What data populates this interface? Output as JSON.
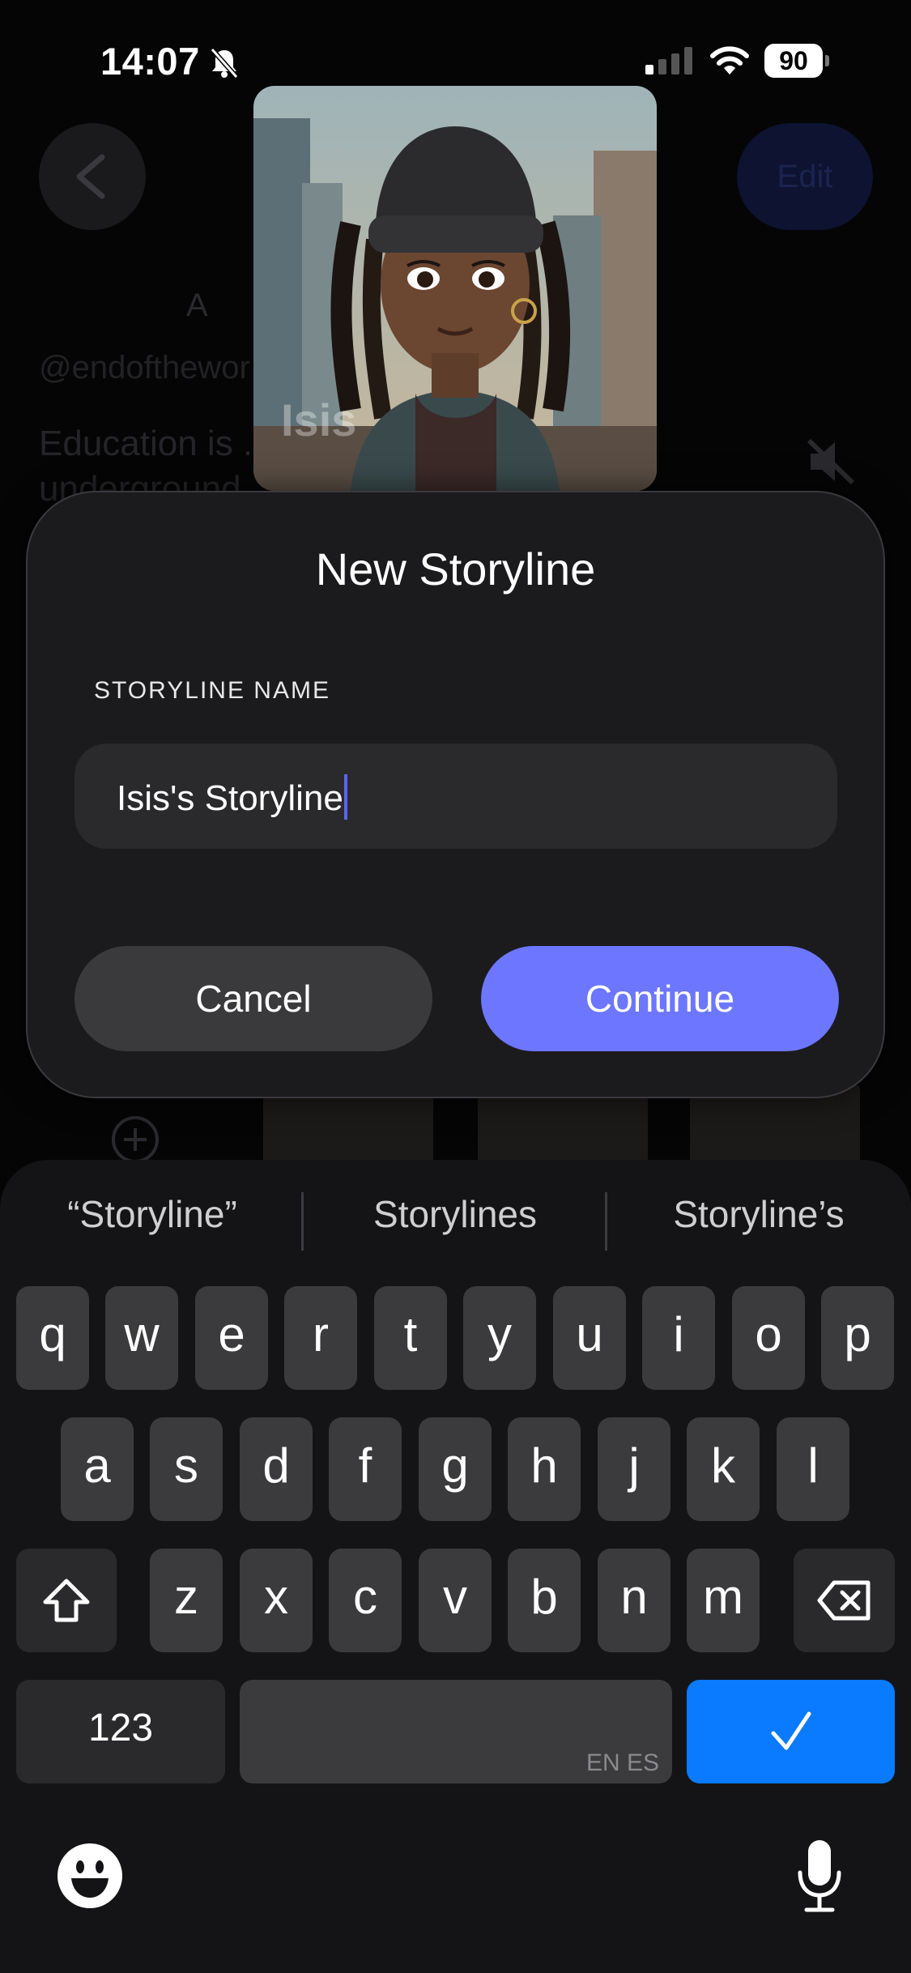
{
  "status_bar": {
    "time": "14:07",
    "battery": "90"
  },
  "background": {
    "edit_label": "Edit",
    "meta_text": "A",
    "handle": "@endofthewor",
    "bio": "Education is ... and I'm the underground"
  },
  "avatar": {
    "name": "Isis"
  },
  "dialog": {
    "title": "New Storyline",
    "field_label": "STORYLINE NAME",
    "input_value": "Isis's Storyline",
    "cancel_label": "Cancel",
    "continue_label": "Continue"
  },
  "keyboard": {
    "suggestions": [
      "“Storyline”",
      "Storylines",
      "Storyline’s"
    ],
    "row1": [
      "q",
      "w",
      "e",
      "r",
      "t",
      "y",
      "u",
      "i",
      "o",
      "p"
    ],
    "row2": [
      "a",
      "s",
      "d",
      "f",
      "g",
      "h",
      "j",
      "k",
      "l"
    ],
    "row3": [
      "z",
      "x",
      "c",
      "v",
      "b",
      "n",
      "m"
    ],
    "numbers_label": "123",
    "language_label": "EN ES",
    "return_label": "✓"
  },
  "colors": {
    "accent": "#6d76ff",
    "return_key": "#0a7aff",
    "dialog_bg": "#1b1b1e"
  }
}
